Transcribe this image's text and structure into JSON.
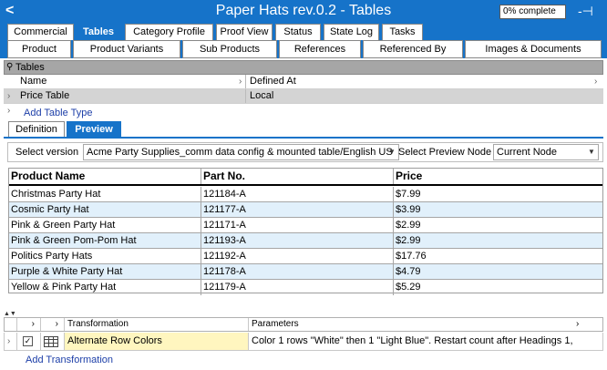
{
  "titlebar": {
    "back_icon": "<",
    "title": "Paper Hats rev.0.2 - Tables",
    "progress": "0% complete",
    "pin_icon": "-⊣"
  },
  "tabs_primary": [
    {
      "label": "Commercial"
    },
    {
      "label": "Tables",
      "active": true
    },
    {
      "label": "Category Profile"
    },
    {
      "label": "Proof View"
    },
    {
      "label": "Status"
    },
    {
      "label": "State Log"
    },
    {
      "label": "Tasks"
    }
  ],
  "tabs_secondary": [
    {
      "label": "Product"
    },
    {
      "label": "Product Variants"
    },
    {
      "label": "Sub Products"
    },
    {
      "label": "References"
    },
    {
      "label": "Referenced By"
    },
    {
      "label": "Images & Documents"
    }
  ],
  "tables_section": {
    "header": "Tables",
    "col_name": "Name",
    "col_defined": "Defined At",
    "row_name": "Price Table",
    "row_defined": "Local",
    "add_link": "Add Table Type"
  },
  "subtabs": [
    {
      "label": "Definition"
    },
    {
      "label": "Preview",
      "active": true
    }
  ],
  "version_bar": {
    "select_version_label": "Select version",
    "version_value": "Acme Party Supplies_comm data config & mounted table/English US",
    "preview_node_label": "Select Preview Node",
    "preview_node_value": "Current Node"
  },
  "preview_table": {
    "headers": [
      "Product Name",
      "Part No.",
      "Price"
    ],
    "rows": [
      [
        "Christmas Party Hat",
        "121184-A",
        "$7.99"
      ],
      [
        "Cosmic Party Hat",
        "121177-A",
        "$3.99"
      ],
      [
        "Pink & Green Party Hat",
        "121171-A",
        "$2.99"
      ],
      [
        "Pink & Green Pom-Pom Hat",
        "121193-A",
        "$2.99"
      ],
      [
        "Politics Party Hats",
        "121192-A",
        "$17.76"
      ],
      [
        "Purple & White Party Hat",
        "121178-A",
        "$4.79"
      ],
      [
        "Yellow & Pink Party Hat",
        "121179-A",
        "$5.29"
      ]
    ]
  },
  "transformations": {
    "col_transformation": "Transformation",
    "col_parameters": "Parameters",
    "row_name": "Alternate Row Colors",
    "row_parameters": "Color 1 rows \"White\" then 1 \"Light Blue\".  Restart count after Headings 1,",
    "add_link": "Add Transformation"
  },
  "colors": {
    "accent": "#1673c9",
    "row_alt": "#e1f0fb",
    "highlight": "#fff6bf"
  }
}
